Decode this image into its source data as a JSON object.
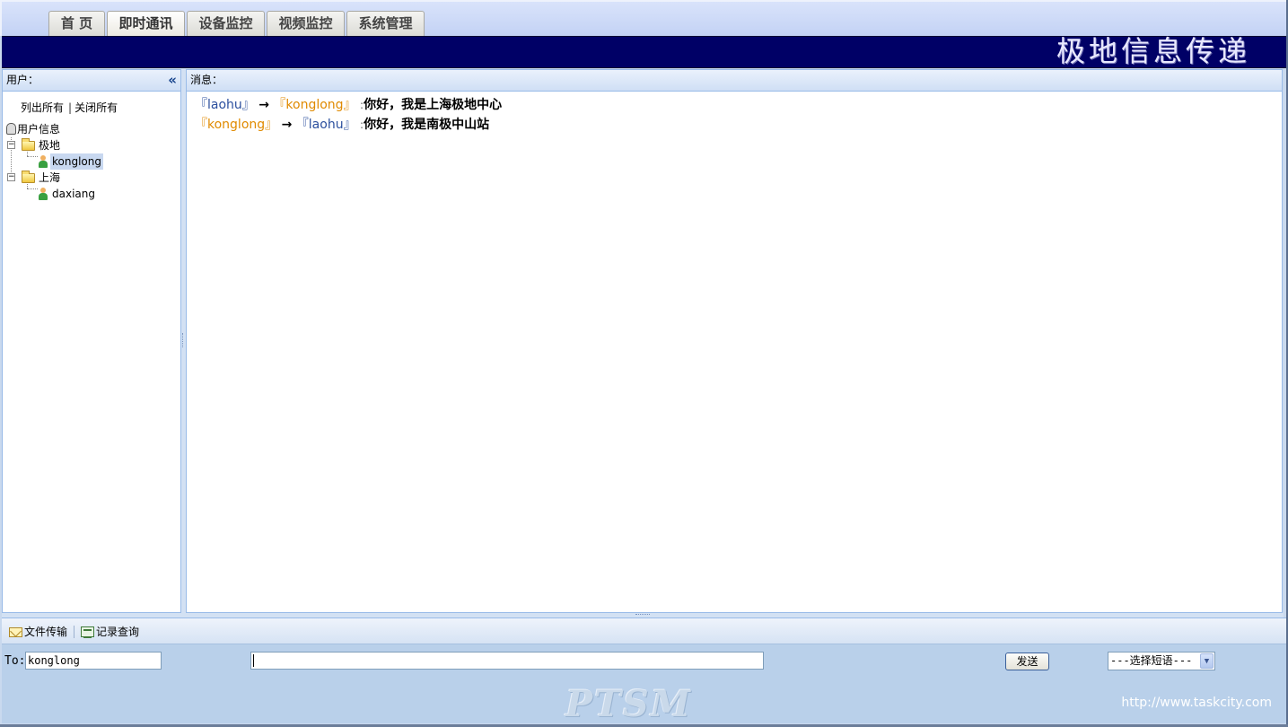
{
  "nav": {
    "tabs": [
      {
        "label": "首 页"
      },
      {
        "label": "即时通讯",
        "active": true
      },
      {
        "label": "设备监控"
      },
      {
        "label": "视频监控"
      },
      {
        "label": "系统管理"
      }
    ]
  },
  "banner": {
    "title": "极地信息传递"
  },
  "users_panel": {
    "title": "用户：",
    "list_all": "列出所有",
    "separator": "|",
    "close_all": "关闭所有",
    "tree": {
      "root": "用户信息",
      "groups": [
        {
          "name": "极地",
          "members": [
            "konglong"
          ]
        },
        {
          "name": "上海",
          "members": [
            "daxiang"
          ]
        }
      ],
      "selected": "konglong"
    }
  },
  "messages_panel": {
    "title": "消息：",
    "messages": [
      {
        "from": "『laohu』",
        "arrow": "→",
        "to": "『konglong』",
        "colon": ":",
        "text": "你好，我是上海极地中心"
      },
      {
        "from": "『konglong』",
        "arrow": "→",
        "to": "『laohu』",
        "colon": ":",
        "text": "你好，我是南极中山站"
      }
    ]
  },
  "toolbar": {
    "file_transfer": "文件传输",
    "record_query": "记录查询"
  },
  "compose": {
    "to_label": "To:",
    "to_value": "konglong",
    "message_value": "",
    "send_label": "发送",
    "phrase_select": "---选择短语---"
  },
  "footer": {
    "watermark": "PTSM",
    "url": "http://www.taskcity.com"
  },
  "colors": {
    "banner_bg": "#000066",
    "panel_border": "#99bbe8",
    "user_blue": "#2b4f9e",
    "user_orange": "#e08a00"
  }
}
